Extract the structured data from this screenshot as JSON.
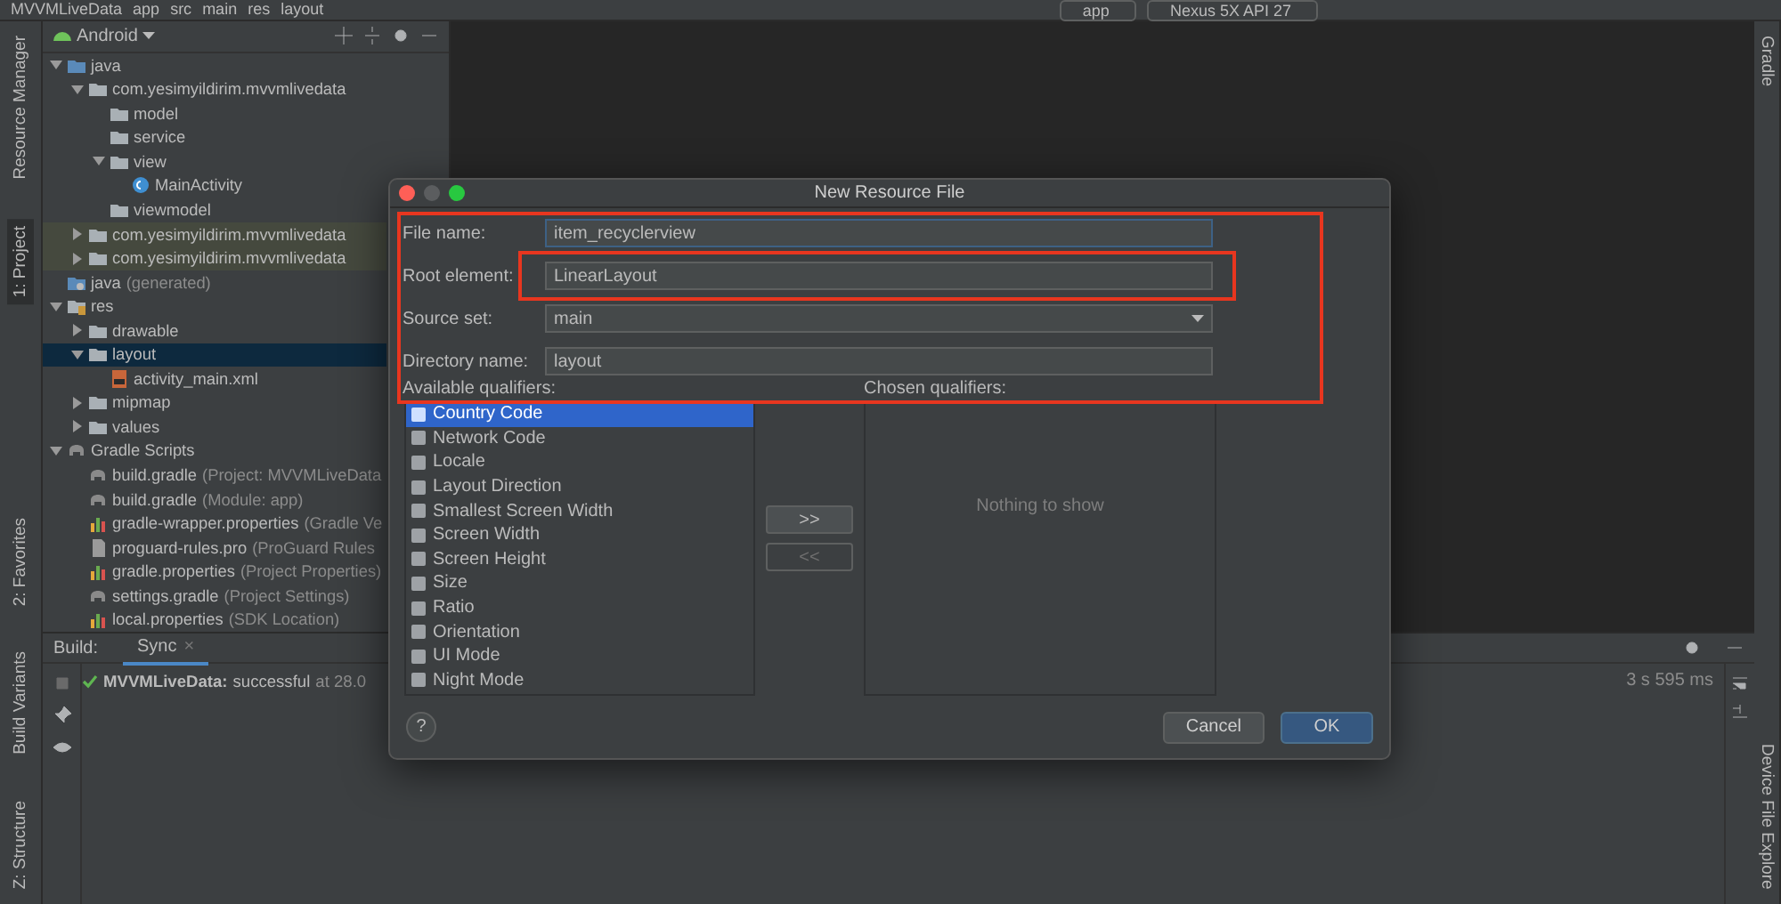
{
  "toolbar": {
    "breadcrumbs": [
      "MVVMLiveData",
      "app",
      "src",
      "main",
      "res",
      "layout"
    ],
    "run_config": "app",
    "device": "Nexus 5X API 27"
  },
  "left_strip": {
    "top": [
      {
        "label": "Resource Manager",
        "selected": false
      },
      {
        "label": "1: Project",
        "selected": true
      }
    ],
    "bottom": [
      {
        "label": "2: Favorites",
        "selected": false
      },
      {
        "label": "Build Variants",
        "selected": false
      },
      {
        "label": "Z: Structure",
        "selected": false
      }
    ]
  },
  "right_strip": {
    "top": [
      {
        "label": "Gradle",
        "selected": false
      }
    ],
    "bottom": [
      {
        "label": "Device File Explore",
        "selected": false
      }
    ]
  },
  "project_panel": {
    "view": "Android",
    "tree": [
      {
        "name": "java",
        "kind": "source-root",
        "expanded": true,
        "selected": false,
        "children": [
          {
            "name": "com.yesimyildirim.mvvmlivedata",
            "kind": "package",
            "expanded": true,
            "selected": false,
            "children": [
              {
                "name": "model",
                "kind": "package",
                "selected": false
              },
              {
                "name": "service",
                "kind": "package",
                "selected": false
              },
              {
                "name": "view",
                "kind": "package",
                "expanded": true,
                "selected": false,
                "children": [
                  {
                    "name": "MainActivity",
                    "kind": "class",
                    "selected": false
                  }
                ]
              },
              {
                "name": "viewmodel",
                "kind": "package",
                "selected": false
              }
            ]
          },
          {
            "name": "com.yesimyildirim.mvvmlivedata",
            "kind": "test-package",
            "expanded": false,
            "selected": false
          },
          {
            "name": "com.yesimyildirim.mvvmlivedata",
            "kind": "test-package",
            "expanded": false,
            "selected": false
          }
        ]
      },
      {
        "name": "java",
        "hint": "(generated)",
        "kind": "generated-root",
        "selected": false
      },
      {
        "name": "res",
        "kind": "res-root",
        "expanded": true,
        "selected": false,
        "children": [
          {
            "name": "drawable",
            "kind": "package",
            "expanded": false,
            "selected": false
          },
          {
            "name": "layout",
            "kind": "package",
            "expanded": true,
            "selected": true,
            "children": [
              {
                "name": "activity_main.xml",
                "kind": "layout-file",
                "selected": false
              }
            ]
          },
          {
            "name": "mipmap",
            "kind": "package",
            "expanded": false,
            "selected": false
          },
          {
            "name": "values",
            "kind": "package",
            "expanded": false,
            "selected": false
          }
        ]
      },
      {
        "name": "Gradle Scripts",
        "kind": "gradle-scripts",
        "expanded": true,
        "selected": false,
        "children": [
          {
            "name": "build.gradle",
            "hint": "(Project: MVVMLiveData",
            "kind": "gradle",
            "selected": false
          },
          {
            "name": "build.gradle",
            "hint": "(Module: app)",
            "kind": "gradle",
            "selected": false
          },
          {
            "name": "gradle-wrapper.properties",
            "hint": "(Gradle Ve",
            "kind": "properties",
            "selected": false
          },
          {
            "name": "proguard-rules.pro",
            "hint": "(ProGuard Rules",
            "kind": "text-file",
            "selected": false
          },
          {
            "name": "gradle.properties",
            "hint": "(Project Properties)",
            "kind": "properties",
            "selected": false
          },
          {
            "name": "settings.gradle",
            "hint": "(Project Settings)",
            "kind": "gradle",
            "selected": false
          },
          {
            "name": "local.properties",
            "hint": "(SDK Location)",
            "kind": "properties",
            "selected": false
          }
        ]
      }
    ]
  },
  "build_panel": {
    "label": "Build:",
    "tabs": [
      {
        "label": "Sync",
        "selected": true
      }
    ],
    "close": "×",
    "message": {
      "title": "MVVMLiveData:",
      "text": "successful",
      "time": "at 28.0"
    },
    "duration": "3 s 595 ms"
  },
  "dialog": {
    "title": "New Resource File",
    "fields": [
      {
        "label": "File name:",
        "value": "item_recyclerview",
        "kind": "text",
        "focused": true
      },
      {
        "label": "Root element:",
        "value": "LinearLayout",
        "kind": "text",
        "focused": false
      },
      {
        "label": "Source set:",
        "value": "main",
        "kind": "dropdown",
        "focused": false
      },
      {
        "label": "Directory name:",
        "value": "layout",
        "kind": "text",
        "focused": false
      }
    ],
    "available_label": "Available qualifiers:",
    "chosen_label": "Chosen qualifiers:",
    "qualifiers": [
      {
        "label": "Country Code",
        "selected": true
      },
      {
        "label": "Network Code",
        "selected": false
      },
      {
        "label": "Locale",
        "selected": false
      },
      {
        "label": "Layout Direction",
        "selected": false
      },
      {
        "label": "Smallest Screen Width",
        "selected": false
      },
      {
        "label": "Screen Width",
        "selected": false
      },
      {
        "label": "Screen Height",
        "selected": false
      },
      {
        "label": "Size",
        "selected": false
      },
      {
        "label": "Ratio",
        "selected": false
      },
      {
        "label": "Orientation",
        "selected": false
      },
      {
        "label": "UI Mode",
        "selected": false
      },
      {
        "label": "Night Mode",
        "selected": false
      }
    ],
    "add_button": {
      "label": ">>",
      "disabled": false
    },
    "remove_button": {
      "label": "<<",
      "disabled": true
    },
    "empty_text": "Nothing to show",
    "help": "?",
    "cancel": "Cancel",
    "ok": "OK"
  }
}
